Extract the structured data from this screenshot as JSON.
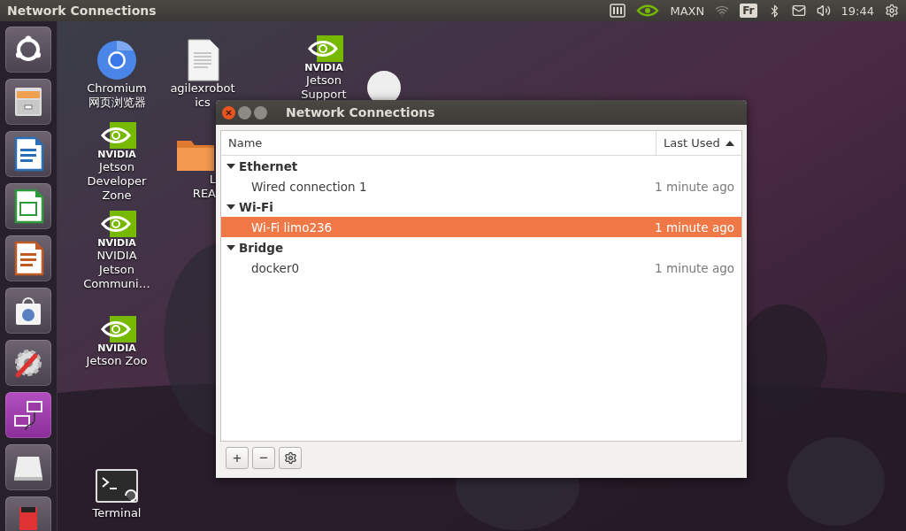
{
  "top_panel": {
    "title": "Network Connections",
    "power_mode": "MAXN",
    "keyboard": "Fr",
    "clock": "19:44"
  },
  "launcher": [
    {
      "kind": "ubuntu",
      "selected": false
    },
    {
      "kind": "files",
      "selected": false
    },
    {
      "kind": "writer",
      "selected": false
    },
    {
      "kind": "calc",
      "selected": false
    },
    {
      "kind": "impress",
      "selected": false
    },
    {
      "kind": "store",
      "selected": false
    },
    {
      "kind": "settings",
      "selected": false
    },
    {
      "kind": "network",
      "selected": true
    },
    {
      "kind": "drive",
      "selected": false
    },
    {
      "kind": "sdcard",
      "selected": false
    }
  ],
  "desktop_icons": [
    {
      "kind": "chromium",
      "lines": [
        "Chromium",
        "网页浏览器"
      ]
    },
    {
      "kind": "document",
      "lines": [
        "agilexrobot",
        "ics"
      ]
    },
    {
      "kind": "nvidia",
      "logo": "NVIDIA",
      "lines": [
        "Jetson",
        "Support"
      ]
    },
    {
      "kind": "nvidia",
      "logo": "NVIDIA",
      "lines": [
        "Jetson",
        "Developer",
        "Zone"
      ]
    },
    {
      "kind": "nvidia",
      "logo": "NVIDIA",
      "lines": [
        "NVIDIA",
        "Jetson",
        "Communi…"
      ]
    },
    {
      "kind": "folder",
      "lines": [
        "L",
        "REA"
      ]
    },
    {
      "kind": "disc"
    },
    {
      "kind": "nvidia",
      "logo": "NVIDIA",
      "lines": [
        "Jetson Zoo"
      ]
    },
    {
      "kind": "terminal",
      "lines": [
        "Terminal"
      ]
    }
  ],
  "window": {
    "title": "Network Connections",
    "columns": [
      {
        "label": "Name",
        "sorted": false
      },
      {
        "label": "Last Used",
        "sorted": true
      }
    ],
    "groups": [
      {
        "name": "Ethernet",
        "expanded": true,
        "connections": [
          {
            "name": "Wired connection 1",
            "last_used": "1 minute ago",
            "selected": false
          }
        ]
      },
      {
        "name": "Wi-Fi",
        "expanded": true,
        "connections": [
          {
            "name": "Wi-Fi limo236",
            "last_used": "1 minute ago",
            "selected": true
          }
        ]
      },
      {
        "name": "Bridge",
        "expanded": true,
        "connections": [
          {
            "name": "docker0",
            "last_used": "1 minute ago",
            "selected": false
          }
        ]
      }
    ],
    "toolbar": [
      {
        "kind": "add",
        "label": "+"
      },
      {
        "kind": "remove",
        "label": "−"
      },
      {
        "kind": "settings"
      }
    ]
  }
}
